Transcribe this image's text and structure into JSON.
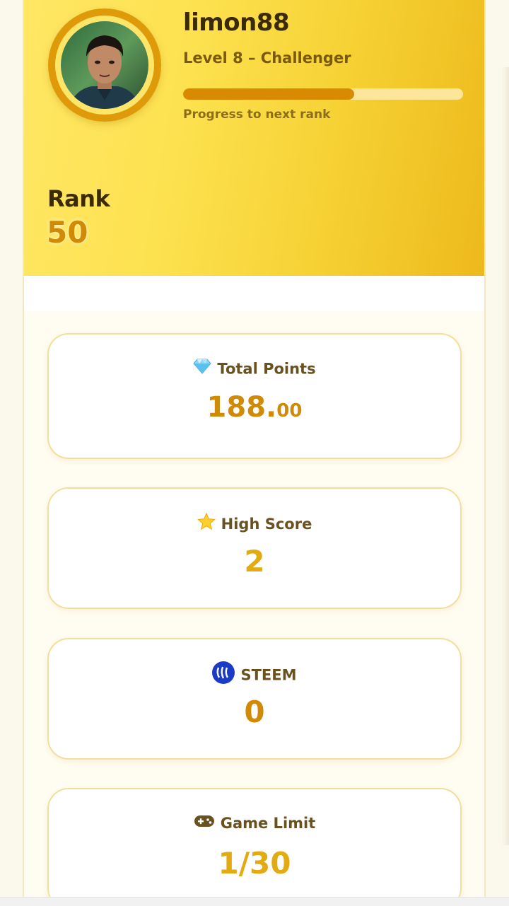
{
  "profile": {
    "username": "limon88",
    "level_text": "Level 8 – Challenger",
    "progress_fraction": 0.61,
    "progress_caption": "Progress to next rank",
    "rank_label": "Rank",
    "rank_value": "50"
  },
  "stats": [
    {
      "icon": "diamond-icon",
      "label": "Total Points",
      "value_main": "188.",
      "value_decimal": "00"
    },
    {
      "icon": "star-icon",
      "label": "High Score",
      "value": "2"
    },
    {
      "icon": "steem-logo-icon",
      "label": "STEEM",
      "value": "0"
    },
    {
      "icon": "gamepad-icon",
      "label": "Game Limit",
      "value": "1/30"
    }
  ],
  "colors": {
    "accent": "#d78a02",
    "header_start": "#ffe765",
    "header_end": "#edb91c",
    "steem_blue": "#1a3bc5"
  }
}
